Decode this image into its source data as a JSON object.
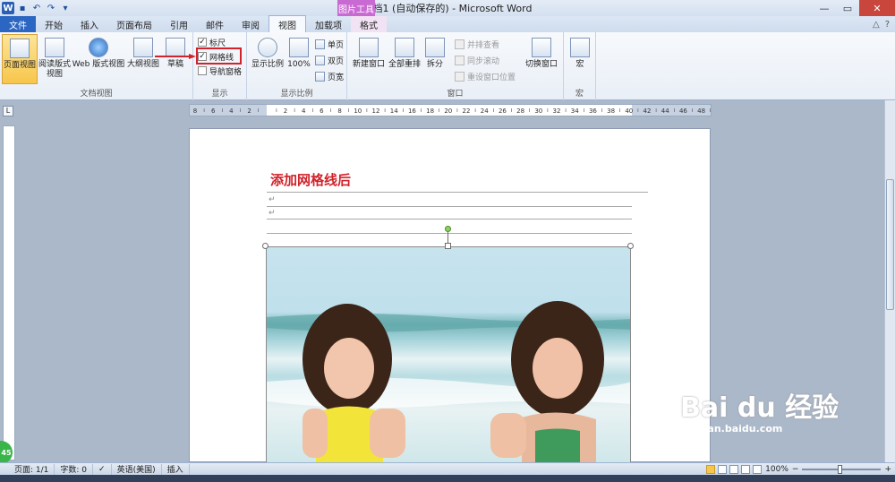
{
  "window": {
    "title": "文档1 (自动保存的) - Microsoft Word",
    "logo": "W",
    "context_header": "图片工具"
  },
  "tabs": [
    {
      "label": "文件"
    },
    {
      "label": "开始"
    },
    {
      "label": "插入"
    },
    {
      "label": "页面布局"
    },
    {
      "label": "引用"
    },
    {
      "label": "邮件"
    },
    {
      "label": "审阅"
    },
    {
      "label": "视图"
    },
    {
      "label": "加载项"
    },
    {
      "label": "格式"
    }
  ],
  "ribbon": {
    "doc_views": {
      "label": "文档视图",
      "print_layout": "页面视图",
      "reading": "阅读版式\n视图",
      "web": "Web 版式视图",
      "outline": "大纲视图",
      "draft": "草稿"
    },
    "show": {
      "label": "显示",
      "ruler": "标尺",
      "gridlines": "网格线",
      "nav_pane": "导航窗格",
      "ruler_checked": "✓",
      "gridlines_checked": "✓"
    },
    "zoom": {
      "label": "显示比例",
      "zoom": "显示比例",
      "hundred": "100%",
      "one_page": "单页",
      "two_pages": "双页",
      "page_width": "页宽"
    },
    "window": {
      "label": "窗口",
      "new_window": "新建窗口",
      "arrange_all": "全部重排",
      "split": "拆分",
      "side_by_side": "并排查看",
      "sync_scroll": "同步滚动",
      "reset_pos": "重设窗口位置",
      "switch": "切换窗口"
    },
    "macros": {
      "label": "宏",
      "macros": "宏"
    }
  },
  "ruler": {
    "corner": "L",
    "ticks": [
      "8",
      "6",
      "4",
      "2",
      "",
      "2",
      "4",
      "6",
      "8",
      "10",
      "12",
      "14",
      "16",
      "18",
      "20",
      "22",
      "24",
      "26",
      "28",
      "30",
      "32",
      "34",
      "36",
      "38",
      "40",
      "42",
      "44",
      "46",
      "48"
    ]
  },
  "document": {
    "heading": "添加网格线后",
    "para1": "↵",
    "para2": "↵"
  },
  "watermark": {
    "brand": "Bai du 经验",
    "url": "jingyan.baidu.com"
  },
  "status": {
    "page": "页面: 1/1",
    "words": "字数: 0",
    "language": "英语(美国)",
    "mode": "插入",
    "zoom": "100%",
    "minus": "−",
    "plus": "+",
    "badge": "45"
  },
  "colors": {
    "accent_red": "#d0232b",
    "file_tab": "#2a66c2",
    "context_tab": "#c86ad2"
  }
}
